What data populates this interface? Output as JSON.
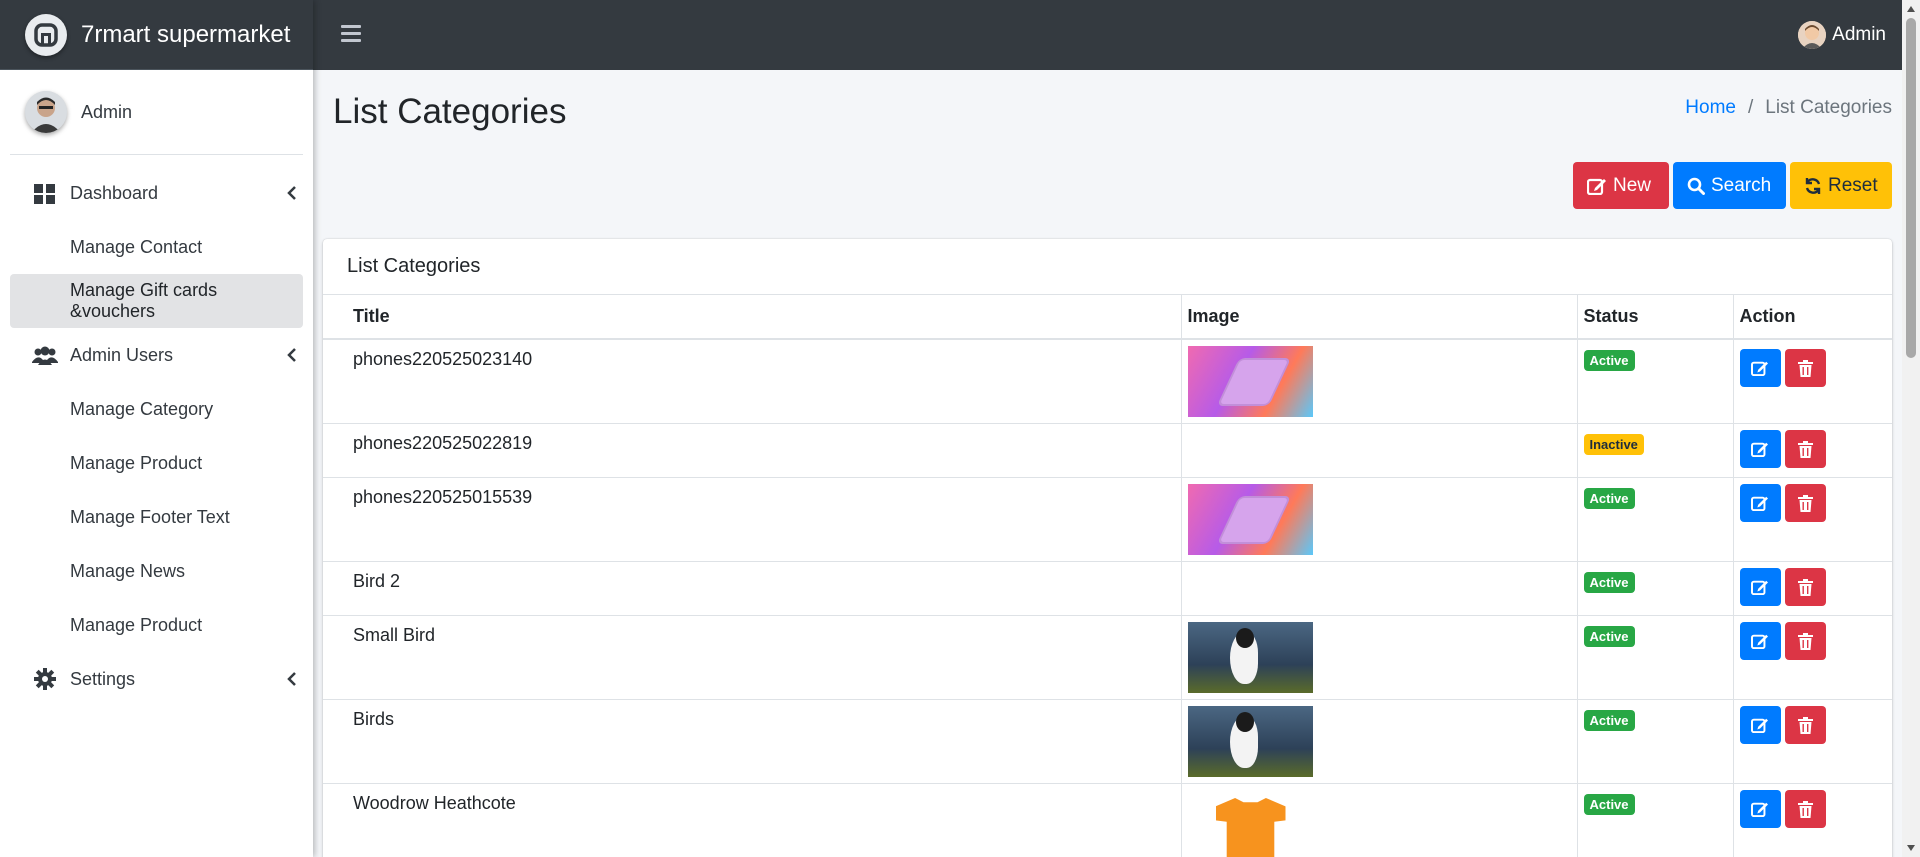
{
  "brand": {
    "name": "7rmart supermarket"
  },
  "sidebar": {
    "user_name": "Admin",
    "items": [
      {
        "label": "Dashboard",
        "icon": "dashboard-icon"
      },
      {
        "label": "Manage Contact"
      },
      {
        "label": "Manage Gift cards &vouchers"
      },
      {
        "label": "Admin Users",
        "icon": "users-icon"
      },
      {
        "label": "Manage Category"
      },
      {
        "label": "Manage Product"
      },
      {
        "label": "Manage Footer Text"
      },
      {
        "label": "Manage News"
      },
      {
        "label": "Manage Product"
      },
      {
        "label": "Settings",
        "icon": "gear-icon"
      }
    ]
  },
  "topbar": {
    "user_name": "Admin"
  },
  "page": {
    "title": "List Categories"
  },
  "breadcrumb": {
    "home": "Home",
    "separator": "/",
    "current": "List Categories"
  },
  "actions": {
    "new": "New",
    "search": "Search",
    "reset": "Reset"
  },
  "card": {
    "title": "List Categories"
  },
  "table": {
    "headers": {
      "title": "Title",
      "image": "Image",
      "status": "Status",
      "action": "Action"
    },
    "rows": [
      {
        "title": "phones220525023140",
        "image": "phone",
        "status": "Active"
      },
      {
        "title": "phones220525022819",
        "image": "",
        "status": "Inactive"
      },
      {
        "title": "phones220525015539",
        "image": "phone",
        "status": "Active"
      },
      {
        "title": "Bird 2",
        "image": "",
        "status": "Active"
      },
      {
        "title": "Small Bird",
        "image": "bird",
        "status": "Active"
      },
      {
        "title": "Birds",
        "image": "bird",
        "status": "Active"
      },
      {
        "title": "Woodrow Heathcote",
        "image": "shirt",
        "status": "Active"
      }
    ]
  },
  "colors": {
    "topbar": "#343a40",
    "primary": "#007bff",
    "danger": "#dc3545",
    "warning": "#ffc107",
    "success": "#28a745"
  }
}
